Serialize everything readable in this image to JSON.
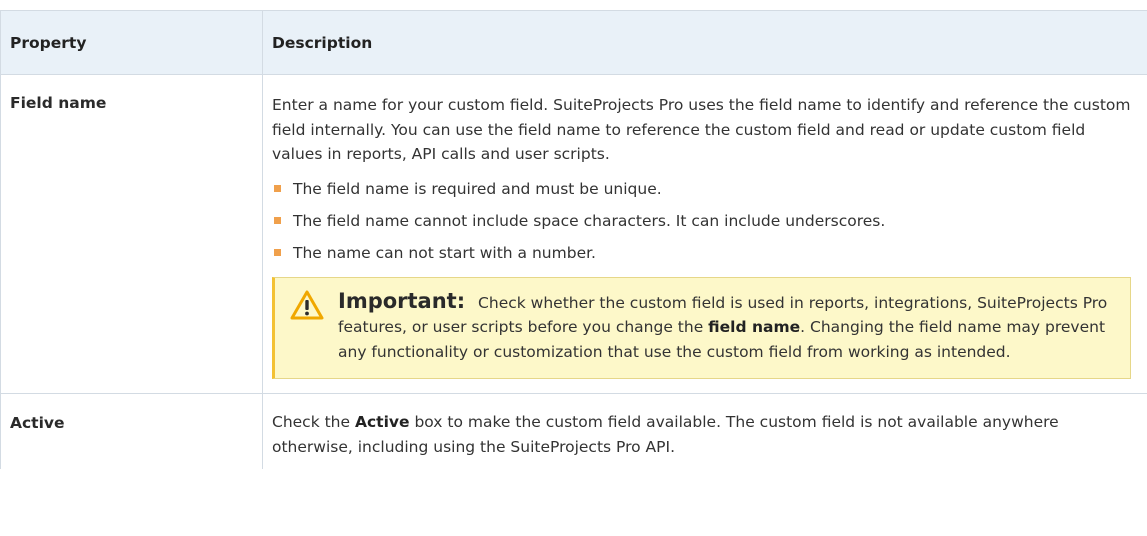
{
  "table": {
    "headers": [
      "Property",
      "Description"
    ],
    "rows": [
      {
        "property": "Field name",
        "description": "Enter a name for your custom field. SuiteProjects Pro uses the field name to identify and reference the custom field internally. You can use the field name to reference the custom field and read or update custom field values in reports, API calls and user scripts.",
        "bullets": [
          "The field name is required and must be unique.",
          "The field name cannot include space characters. It can include underscores.",
          "The name can not start with a number."
        ],
        "note": {
          "icon": "warning-triangle-icon",
          "title": "Important:",
          "text_before": "Check whether the custom field is used in reports, integrations, SuiteProjects Pro features, or user scripts before you change the",
          "bold": "field name",
          "text_after": ". Changing the field name may prevent any functionality or customization that use the custom field from working as intended."
        }
      },
      {
        "property": "Active",
        "text_before": "Check the",
        "bold": "Active",
        "text_after": "box to make the custom field available. The custom field is not available anywhere otherwise, including using the SuiteProjects Pro API."
      }
    ]
  },
  "colors": {
    "header_bg": "#e9f1f8",
    "border": "#d3dbe3",
    "bullet": "#f0a04b",
    "note_bg": "#fdf8c9",
    "note_accent": "#f3c133"
  }
}
